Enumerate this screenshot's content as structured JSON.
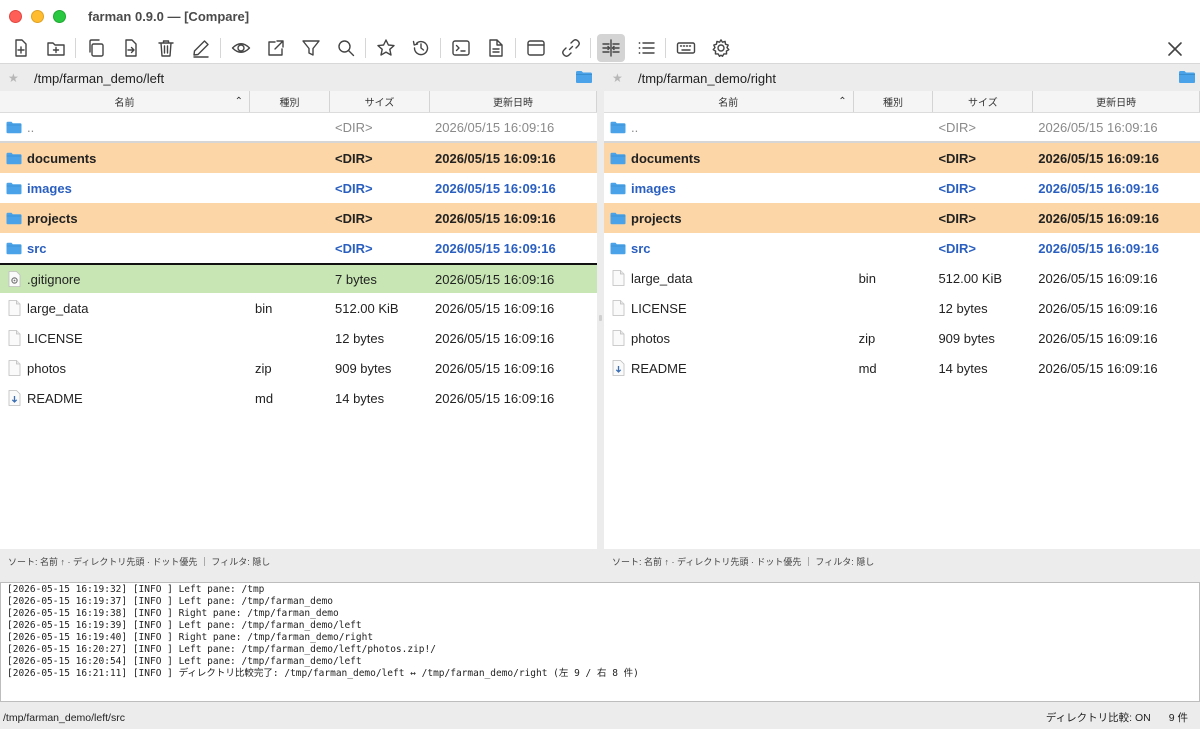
{
  "window": {
    "title": "farman 0.9.0 — [Compare]"
  },
  "toolbar": {
    "buttons": [
      {
        "icon": "new-file-icon"
      },
      {
        "icon": "new-folder-icon"
      },
      {
        "icon": "copy-icon"
      },
      {
        "icon": "move-icon"
      },
      {
        "icon": "trash-icon"
      },
      {
        "icon": "rename-icon"
      },
      {
        "icon": "view-icon"
      },
      {
        "icon": "open-external-icon"
      },
      {
        "icon": "filter-icon"
      },
      {
        "icon": "search-icon"
      },
      {
        "icon": "bookmark-icon"
      },
      {
        "icon": "history-icon"
      },
      {
        "icon": "terminal-icon"
      },
      {
        "icon": "document-icon"
      },
      {
        "icon": "window-icon"
      },
      {
        "icon": "link-icon"
      },
      {
        "icon": "compare-icon",
        "active": true
      },
      {
        "icon": "list-icon"
      },
      {
        "icon": "keyboard-icon"
      },
      {
        "icon": "settings-icon"
      }
    ],
    "close_icon": "close-icon"
  },
  "columns": {
    "name": "名前",
    "type": "種別",
    "size": "サイズ",
    "date": "更新日時",
    "sort_arrow": "^"
  },
  "left_pane": {
    "path": "/tmp/farman_demo/left",
    "rows": [
      {
        "name": "..",
        "type": "",
        "size": "<DIR>",
        "date": "2026/05/15 16:09:16",
        "kind": "parent"
      },
      {
        "name": "documents",
        "type": "",
        "size": "<DIR>",
        "date": "2026/05/15 16:09:16",
        "kind": "dir-orange"
      },
      {
        "name": "images",
        "type": "",
        "size": "<DIR>",
        "date": "2026/05/15 16:09:16",
        "kind": "dir-blue"
      },
      {
        "name": "projects",
        "type": "",
        "size": "<DIR>",
        "date": "2026/05/15 16:09:16",
        "kind": "dir-orange"
      },
      {
        "name": "src",
        "type": "",
        "size": "<DIR>",
        "date": "2026/05/15 16:09:16",
        "kind": "dir-blue"
      },
      {
        "name": ".gitignore",
        "type": "",
        "size": "7 bytes",
        "date": "2026/05/15 16:09:16",
        "kind": "file-green"
      },
      {
        "name": "large_data",
        "type": "bin",
        "size": "512.00 KiB",
        "date": "2026/05/15 16:09:16",
        "kind": "file"
      },
      {
        "name": "LICENSE",
        "type": "",
        "size": "12 bytes",
        "date": "2026/05/15 16:09:16",
        "kind": "file"
      },
      {
        "name": "photos",
        "type": "zip",
        "size": "909 bytes",
        "date": "2026/05/15 16:09:16",
        "kind": "file"
      },
      {
        "name": "README",
        "type": "md",
        "size": "14 bytes",
        "date": "2026/05/15 16:09:16",
        "kind": "file-md"
      }
    ],
    "sort_status": "ソート: 名前 ↑ · ディレクトリ先頭 · ドット優先 ｜ フィルタ: 隠し"
  },
  "right_pane": {
    "path": "/tmp/farman_demo/right",
    "rows": [
      {
        "name": "..",
        "type": "",
        "size": "<DIR>",
        "date": "2026/05/15 16:09:16",
        "kind": "parent"
      },
      {
        "name": "documents",
        "type": "",
        "size": "<DIR>",
        "date": "2026/05/15 16:09:16",
        "kind": "dir-orange"
      },
      {
        "name": "images",
        "type": "",
        "size": "<DIR>",
        "date": "2026/05/15 16:09:16",
        "kind": "dir-blue"
      },
      {
        "name": "projects",
        "type": "",
        "size": "<DIR>",
        "date": "2026/05/15 16:09:16",
        "kind": "dir-orange"
      },
      {
        "name": "src",
        "type": "",
        "size": "<DIR>",
        "date": "2026/05/15 16:09:16",
        "kind": "dir-blue"
      },
      {
        "name": "large_data",
        "type": "bin",
        "size": "512.00 KiB",
        "date": "2026/05/15 16:09:16",
        "kind": "file"
      },
      {
        "name": "LICENSE",
        "type": "",
        "size": "12 bytes",
        "date": "2026/05/15 16:09:16",
        "kind": "file"
      },
      {
        "name": "photos",
        "type": "zip",
        "size": "909 bytes",
        "date": "2026/05/15 16:09:16",
        "kind": "file"
      },
      {
        "name": "README",
        "type": "md",
        "size": "14 bytes",
        "date": "2026/05/15 16:09:16",
        "kind": "file-md"
      }
    ],
    "sort_status": "ソート: 名前 ↑ · ディレクトリ先頭 · ドット優先 ｜ フィルタ: 隠し"
  },
  "log": [
    "[2026-05-15 16:19:32] [INFO ] Left pane: /tmp",
    "[2026-05-15 16:19:37] [INFO ] Left pane: /tmp/farman_demo",
    "[2026-05-15 16:19:38] [INFO ] Right pane: /tmp/farman_demo",
    "[2026-05-15 16:19:39] [INFO ] Left pane: /tmp/farman_demo/left",
    "[2026-05-15 16:19:40] [INFO ] Right pane: /tmp/farman_demo/right",
    "[2026-05-15 16:20:27] [INFO ] Left pane: /tmp/farman_demo/left/photos.zip!/",
    "[2026-05-15 16:20:54] [INFO ] Left pane: /tmp/farman_demo/left",
    "[2026-05-15 16:21:11] [INFO ] ディレクトリ比較完了: /tmp/farman_demo/left ↔ /tmp/farman_demo/right (左 9 / 右 8 件)"
  ],
  "statusbar": {
    "path": "/tmp/farman_demo/left/src",
    "compare": "ディレクトリ比較: ON",
    "count": "9 件"
  },
  "colors": {
    "orange_row": "#fcd6a6",
    "green_row": "#c7e6b3",
    "blue_text": "#2a5fc0",
    "folder": "#4aa3e8"
  }
}
